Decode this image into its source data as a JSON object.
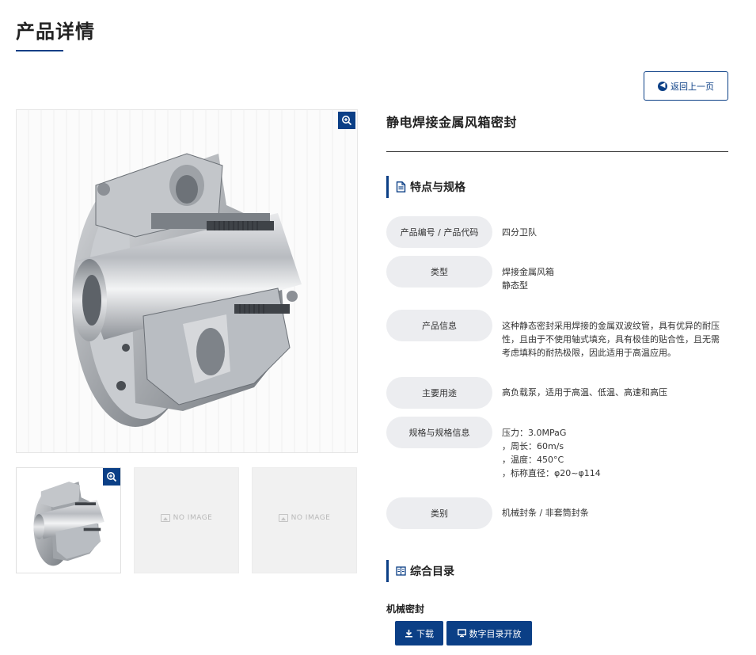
{
  "page": {
    "title": "产品详情"
  },
  "back_button": {
    "label": "返回上一页"
  },
  "product": {
    "name": "静电焊接金属风箱密封"
  },
  "features_section": {
    "title": "特点与规格",
    "rows": [
      {
        "label": "产品编号 / 产品代码",
        "value_lines": [
          "四分卫队"
        ]
      },
      {
        "label": "类型",
        "value_lines": [
          "焊接金属风箱",
          "静态型"
        ]
      },
      {
        "label": "产品信息",
        "value_lines": [
          "这种静态密封采用焊接的金属双波纹管，具有优异的耐压",
          "性，且由于不使用轴式填充，具有极佳的贴合性，且无需",
          "考虑填料的耐热极限，因此适用于高温应用。"
        ]
      },
      {
        "label": "主要用途",
        "value_lines": [
          "高负载泵，适用于高温、低温、高速和高压"
        ]
      },
      {
        "label": "规格与规格信息",
        "value_lines": [
          "压力：3.0MPaG",
          "，周长：60m/s",
          "，温度：450°C",
          "，标称直径：φ20~φ114"
        ]
      },
      {
        "label": "类别",
        "value_lines": [
          "机械封条 / 非套筒封条"
        ]
      }
    ]
  },
  "catalog_section": {
    "title": "综合目录",
    "category": "机械密封",
    "download_label": "下载",
    "digital_catalog_label": "数字目录开放"
  },
  "gallery": {
    "no_image_text": "NO IMAGE"
  },
  "colors": {
    "accent": "#0b3f86",
    "label_bg": "#ecedf0"
  }
}
